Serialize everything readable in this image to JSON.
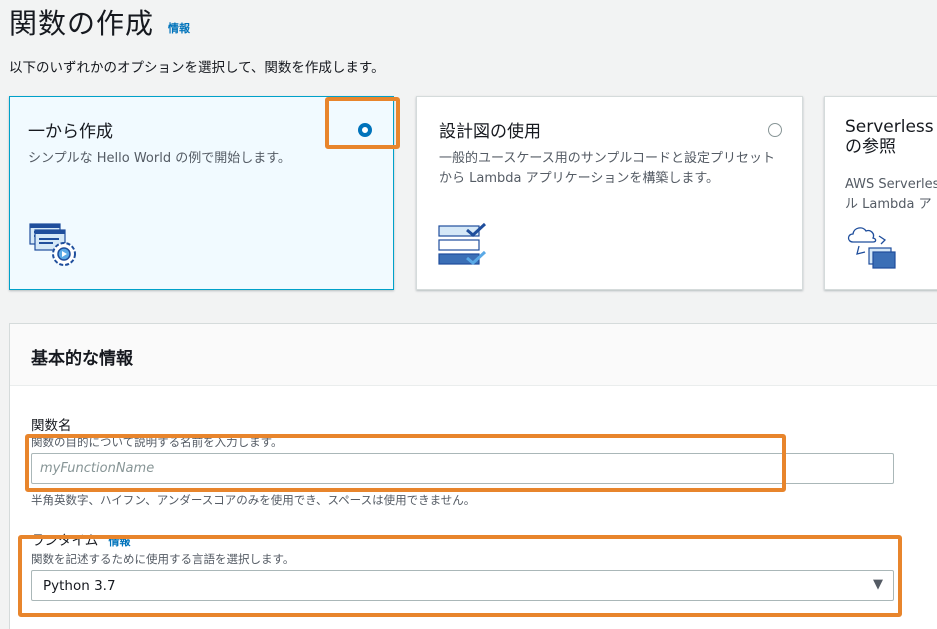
{
  "page": {
    "title": "関数の作成",
    "info_link": "情報",
    "subtitle": "以下のいずれかのオプションを選択して、関数を作成します。"
  },
  "options": [
    {
      "title": "一から作成",
      "description": "シンプルな Hello World の例で開始します。",
      "selected": true,
      "icon": "code-window-gear-icon"
    },
    {
      "title": "設計図の使用",
      "description": "一般的ユースケース用のサンプルコードと設定プリセットから Lambda アプリケーションを構築します。",
      "selected": false,
      "icon": "blueprint-checklist-icon"
    },
    {
      "title": "Serverless\nの参照",
      "description": "AWS Serverles\nル Lambda ア",
      "selected": false,
      "icon": "cloud-repository-icon"
    }
  ],
  "basic_info": {
    "title": "基本的な情報",
    "function_name": {
      "label": "関数名",
      "description": "関数の目的について説明する名前を入力します。",
      "placeholder": "myFunctionName",
      "value": "",
      "hint": "半角英数字、ハイフン、アンダースコアのみを使用でき、スペースは使用できません。"
    },
    "runtime": {
      "label": "ランタイム",
      "info_link": "情報",
      "description": "関数を記述するために使用する言語を選択します。",
      "selected": "Python 3.7"
    }
  },
  "colors": {
    "accent": "#0073bb",
    "highlight": "#e8852c",
    "selected_card_bg": "#f1faff",
    "selected_card_border": "#00a1c9"
  }
}
